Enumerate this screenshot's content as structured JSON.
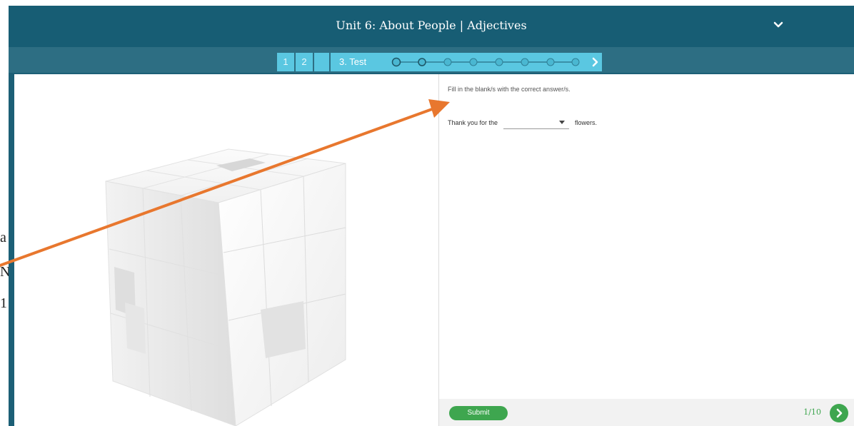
{
  "header": {
    "title": "Unit 6: About People | Adjectives"
  },
  "steps": {
    "items": [
      {
        "label": "1"
      },
      {
        "label": "2"
      }
    ],
    "active_label": "3. Test",
    "progress_dots": 8,
    "visited_dots": 2
  },
  "question": {
    "instruction": "Fill in the blank/s with the correct answer/s.",
    "before_blank": "Thank you for the",
    "blank_value": "",
    "after_blank": "flowers."
  },
  "footer": {
    "submit_label": "Submit",
    "counter": "1/10"
  },
  "background_text": {
    "lines": [
      "a",
      "N",
      "1"
    ]
  },
  "colors": {
    "header": "#175d74",
    "subbar": "#2d6e83",
    "step_accent": "#5ac7e1",
    "success": "#3ea64f",
    "annotation_arrow": "#e8772e"
  }
}
